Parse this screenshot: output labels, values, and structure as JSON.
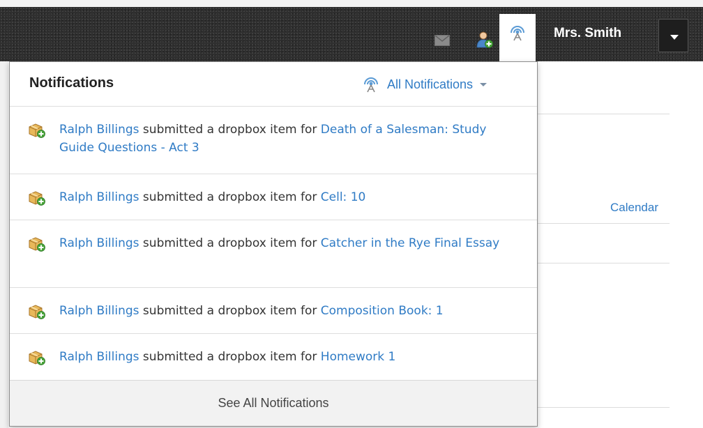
{
  "header": {
    "user_name": "Mrs. Smith",
    "icons": [
      "mail-icon",
      "user-add-icon",
      "notifications-broadcast-icon",
      "caret-down-icon"
    ]
  },
  "background": {
    "calendar_link": "Calendar"
  },
  "panel": {
    "title": "Notifications",
    "filter_label": "All Notifications",
    "footer_label": "See All Notifications",
    "accent_color": "#2f7bc5",
    "items": [
      {
        "actor": "Ralph Billings",
        "action": " submitted a dropbox item for ",
        "target": "Death of a Salesman: Study Guide Questions - Act 3"
      },
      {
        "actor": "Ralph Billings",
        "action": " submitted a dropbox item for ",
        "target": "Cell: 10"
      },
      {
        "actor": "Ralph Billings",
        "action": " submitted a dropbox item for ",
        "target": "Catcher in the Rye Final Essay"
      },
      {
        "actor": "Ralph Billings",
        "action": " submitted a dropbox item for ",
        "target": "Composition Book: 1"
      },
      {
        "actor": "Ralph Billings",
        "action": " submitted a dropbox item for ",
        "target": "Homework 1"
      }
    ]
  }
}
